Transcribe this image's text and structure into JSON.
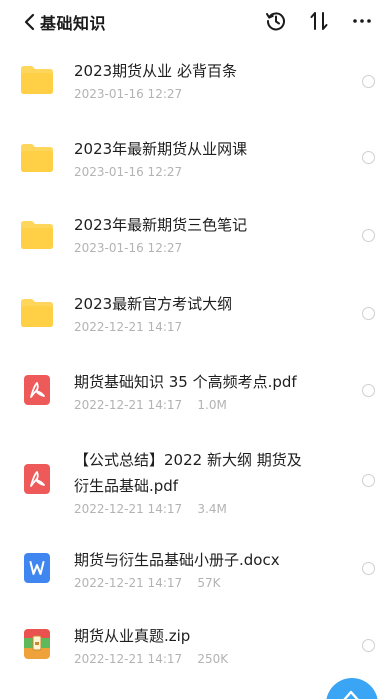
{
  "header": {
    "back_label": "基础知识",
    "history_icon": "history-icon",
    "sort_icon": "sort-icon",
    "more_icon": "more-icon"
  },
  "files": [
    {
      "name": "2023期货从业 必背百条",
      "meta": "2023-01-16 12:27",
      "type": "folder"
    },
    {
      "name": "2023年最新期货从业网课",
      "meta": "2023-01-16 12:27",
      "type": "folder"
    },
    {
      "name": "2023年最新期货三色笔记",
      "meta": "2023-01-16 12:27",
      "type": "folder"
    },
    {
      "name": "2023最新官方考试大纲",
      "meta": "2022-12-21 14:17",
      "type": "folder"
    },
    {
      "name": "期货基础知识 35 个高频考点.pdf",
      "meta": "2022-12-21 14:17    1.0M",
      "type": "pdf"
    },
    {
      "name_line1": "【公式总结】2022 新大纲 期货及",
      "name_line2": "衍生品基础.pdf",
      "meta": "2022-12-21 14:17    3.4M",
      "type": "pdf"
    },
    {
      "name": "期货与衍生品基础小册子.docx",
      "meta": "2022-12-21 14:17    57K",
      "type": "docx"
    },
    {
      "name": "期货从业真题.zip",
      "meta": "2022-12-21 14:17    250K",
      "type": "zip"
    }
  ],
  "colors": {
    "folder": "#ffd65c",
    "pdf": "#ee5a5a",
    "docx": "#3f86f0",
    "zip_top": "#e9524f",
    "zip_mid": "#5fb85a",
    "zip_bot": "#f0a23a",
    "fab": "#3aa5f4"
  }
}
